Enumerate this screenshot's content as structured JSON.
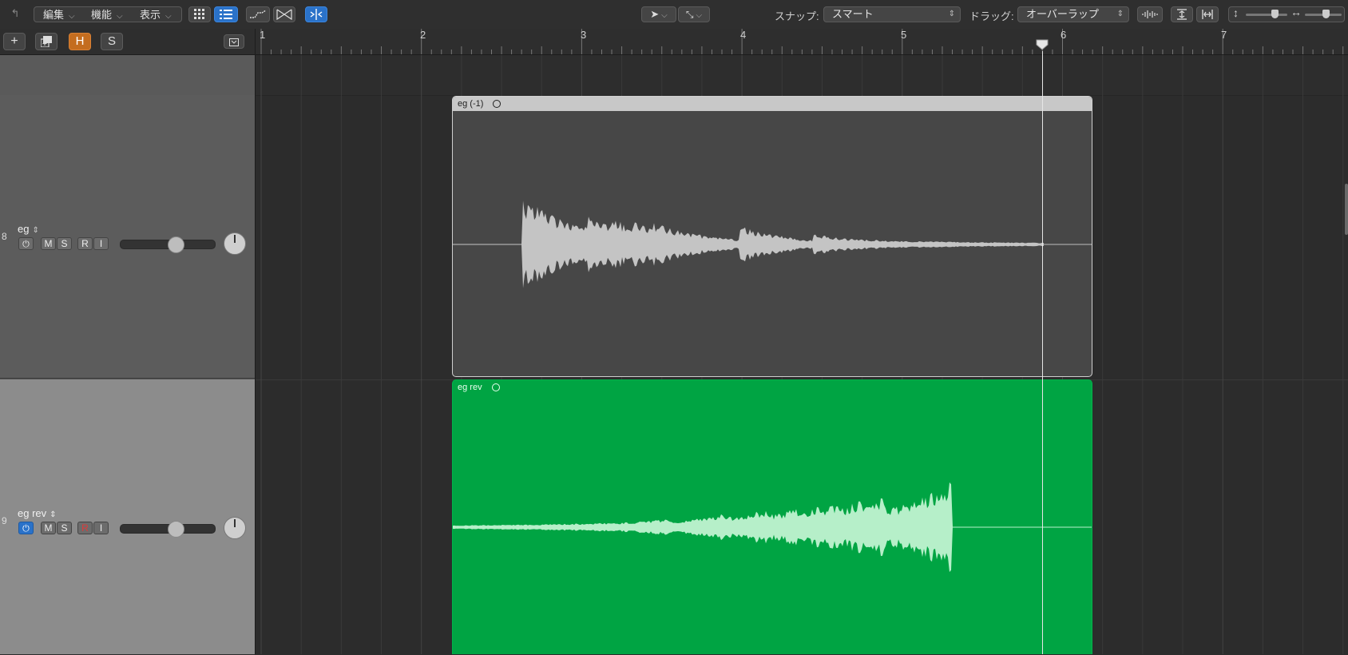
{
  "toolbar": {
    "menus": [
      "編集",
      "機能",
      "表示"
    ],
    "snap_label": "スナップ:",
    "snap_value": "スマート",
    "drag_label": "ドラッグ:",
    "drag_value": "オーバーラップ"
  },
  "header": {
    "add": "+",
    "hide": "H",
    "solo": "S"
  },
  "ruler": {
    "bars": [
      "1",
      "2",
      "3",
      "4",
      "5",
      "6",
      "7"
    ]
  },
  "tracks": [
    {
      "number": "8",
      "name": "eg",
      "mute": "M",
      "solo": "S",
      "rec": "R",
      "input": "I",
      "power_on": false
    },
    {
      "number": "9",
      "name": "eg rev",
      "mute": "M",
      "solo": "S",
      "rec": "R",
      "input": "I",
      "power_on": true
    }
  ],
  "regions": [
    {
      "name": "eg (-1)"
    },
    {
      "name": "eg rev"
    }
  ],
  "colors": {
    "accent_green": "#00a443",
    "region_gray": "#474747",
    "h_button": "#c46d1f"
  }
}
